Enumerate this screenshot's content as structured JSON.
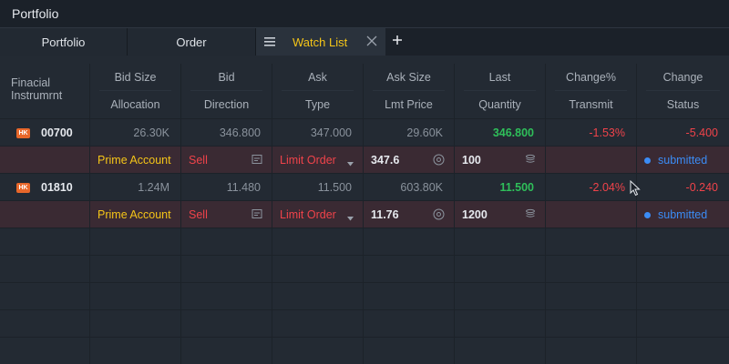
{
  "window": {
    "title": "Portfolio"
  },
  "tabs": [
    {
      "label": "Portfolio"
    },
    {
      "label": "Order"
    },
    {
      "label": "Watch List"
    }
  ],
  "columns": [
    {
      "top": "Finacial Instrumrnt",
      "bottom": ""
    },
    {
      "top": "Bid Size",
      "bottom": "Allocation"
    },
    {
      "top": "Bid",
      "bottom": "Direction"
    },
    {
      "top": "Ask",
      "bottom": "Type"
    },
    {
      "top": "Ask Size",
      "bottom": "Lmt Price"
    },
    {
      "top": "Last",
      "bottom": "Quantity"
    },
    {
      "top": "Change%",
      "bottom": "Transmit"
    },
    {
      "top": "Change",
      "bottom": "Status"
    }
  ],
  "rows": [
    {
      "market": "HK",
      "code": "00700",
      "bid_size": "26.30K",
      "bid": "346.800",
      "ask": "347.000",
      "ask_size": "29.60K",
      "last": "346.800",
      "change_pct": "-1.53%",
      "change": "-5.400",
      "order": {
        "allocation": "Prime Account",
        "direction": "Sell",
        "type": "Limit Order",
        "lmt_price": "347.6",
        "quantity": "100",
        "transmit": "",
        "status": "submitted"
      }
    },
    {
      "market": "HK",
      "code": "01810",
      "bid_size": "1.24M",
      "bid": "11.480",
      "ask": "11.500",
      "ask_size": "603.80K",
      "last": "11.500",
      "change_pct": "-2.04%",
      "change": "-0.240",
      "order": {
        "allocation": "Prime Account",
        "direction": "Sell",
        "type": "Limit Order",
        "lmt_price": "11.76",
        "quantity": "1200",
        "transmit": "",
        "status": "submitted"
      }
    }
  ],
  "colors": {
    "background": "#232a33",
    "accent_yellow": "#f5c518",
    "positive": "#2fbf5a",
    "negative": "#f0434a",
    "status_blue": "#3b8cf5",
    "badge_orange": "#e8672a",
    "order_row_bg": "#3a2a33"
  },
  "icons": [
    "menu-icon",
    "close-icon",
    "plus-icon",
    "hk-badge",
    "calendar-icon",
    "dropdown-caret-icon",
    "target-icon",
    "stack-icon",
    "status-dot",
    "mouse-cursor"
  ]
}
